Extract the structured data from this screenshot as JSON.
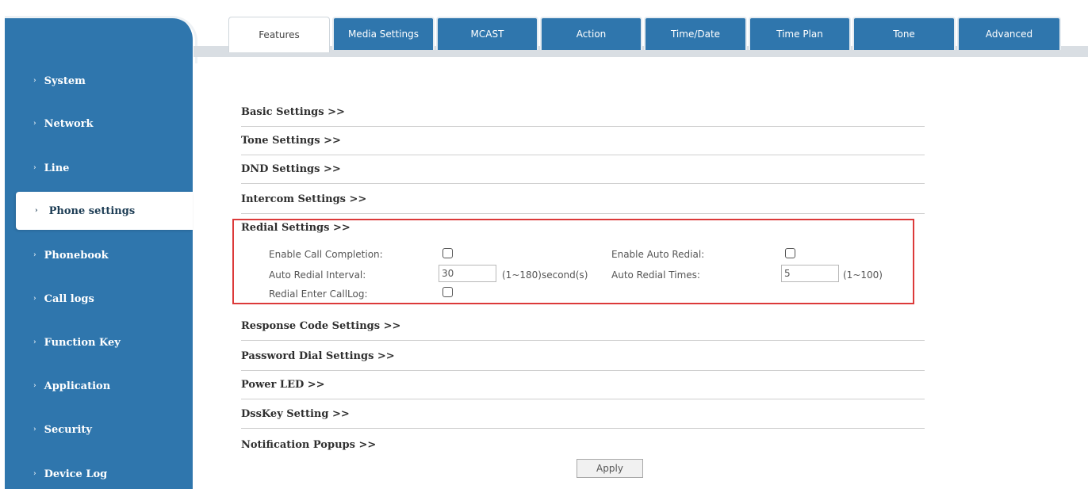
{
  "sidebar": {
    "items": [
      {
        "label": "System"
      },
      {
        "label": "Network"
      },
      {
        "label": "Line"
      },
      {
        "label": "Phone settings"
      },
      {
        "label": "Phonebook"
      },
      {
        "label": "Call logs"
      },
      {
        "label": "Function Key"
      },
      {
        "label": "Application"
      },
      {
        "label": "Security"
      },
      {
        "label": "Device Log"
      }
    ],
    "active": "Phone settings"
  },
  "tabs": [
    {
      "label": "Features"
    },
    {
      "label": "Media Settings"
    },
    {
      "label": "MCAST"
    },
    {
      "label": "Action"
    },
    {
      "label": "Time/Date"
    },
    {
      "label": "Time Plan"
    },
    {
      "label": "Tone"
    },
    {
      "label": "Advanced"
    }
  ],
  "sections": {
    "basic": "Basic Settings >>",
    "tone": "Tone Settings >>",
    "dnd": "DND Settings >>",
    "intercom": "Intercom Settings >>",
    "redial": "Redial Settings >>",
    "response_code": "Response Code Settings >>",
    "password_dial": "Password Dial Settings >>",
    "power_led": "Power LED >>",
    "dsskey": "DssKey Setting >>",
    "notification": "Notification Popups >>"
  },
  "redial": {
    "enable_call_completion_label": "Enable Call Completion:",
    "enable_call_completion": false,
    "enable_auto_redial_label": "Enable Auto Redial:",
    "enable_auto_redial": false,
    "auto_redial_interval_label": "Auto Redial Interval:",
    "auto_redial_interval_value": "30",
    "auto_redial_interval_hint": "(1~180)second(s)",
    "auto_redial_times_label": "Auto Redial Times:",
    "auto_redial_times_value": "5",
    "auto_redial_times_hint": "(1~100)",
    "redial_enter_calllog_label": "Redial Enter CallLog:",
    "redial_enter_calllog": false
  },
  "apply_label": "Apply",
  "colors": {
    "sidebar": "#2f76ad",
    "highlight_border": "#dc3a3a"
  }
}
